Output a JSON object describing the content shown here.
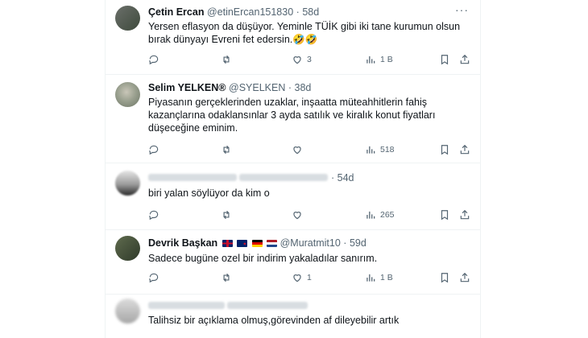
{
  "tweets": [
    {
      "name": "Çetin Ercan",
      "handle": "@etinErcan151830",
      "sep": "·",
      "time": "58d",
      "text": "Yersen eflasyon da düşüyor. Yeminle TÜİK gibi iki tane kurumun olsun bırak dünyayı Evreni fet edersin.🤣🤣",
      "replies": "",
      "retweets": "",
      "likes": "3",
      "views": "1 B"
    },
    {
      "name": "Selim YELKEN®",
      "handle": "@SYELKEN",
      "sep": "·",
      "time": "38d",
      "text": "Piyasanın gerçeklerinden uzaklar, inşaatta müteahhitlerin fahiş kazançlarına odaklansınlar 3 ayda satılık ve kiralık konut fiyatları düşeceğine eminim.",
      "replies": "",
      "retweets": "",
      "likes": "",
      "views": "518"
    },
    {
      "name": "",
      "handle": "",
      "sep": "·",
      "time": "54d",
      "text": "biri yalan söylüyor da kim o",
      "replies": "",
      "retweets": "",
      "likes": "",
      "views": "265"
    },
    {
      "name": "Devrik Başkan",
      "handle": "@Muratmit10",
      "sep": "·",
      "time": "59d",
      "text": "Sadece bugüne ozel bir indirim yakaladılar sanırım.",
      "replies": "",
      "retweets": "",
      "likes": "1",
      "views": "1 B"
    },
    {
      "name": "",
      "handle": "",
      "sep": "",
      "time": "",
      "text": "Talihsiz bir açıklama olmuş,görevinden af dileyebilir artık"
    }
  ],
  "icons": {
    "more": "more-icon",
    "reply": "reply-icon",
    "retweet": "retweet-icon",
    "like": "heart-icon",
    "views": "views-icon",
    "bookmark": "bookmark-icon",
    "share": "share-icon"
  },
  "colors": {
    "text": "#0f1419",
    "muted": "#536471",
    "border": "#eff3f4"
  }
}
